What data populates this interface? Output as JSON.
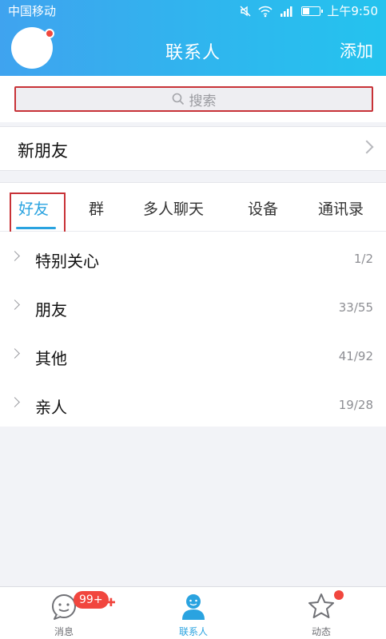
{
  "status_bar": {
    "carrier": "中国移动",
    "time": "上午9:50"
  },
  "header": {
    "title": "联系人",
    "add_label": "添加"
  },
  "search": {
    "placeholder": "搜索"
  },
  "new_friends": {
    "label": "新朋友"
  },
  "tabs": [
    {
      "label": "好友",
      "active": true
    },
    {
      "label": "群"
    },
    {
      "label": "多人聊天"
    },
    {
      "label": "设备"
    },
    {
      "label": "通讯录"
    }
  ],
  "groups": [
    {
      "name": "特别关心",
      "count": "1/2"
    },
    {
      "name": "朋友",
      "count": "33/55"
    },
    {
      "name": "其他",
      "count": "41/92"
    },
    {
      "name": "亲人",
      "count": "19/28"
    }
  ],
  "bottom_nav": {
    "items": [
      {
        "label": "消息",
        "badge": "99+"
      },
      {
        "label": "联系人",
        "active": true
      },
      {
        "label": "动态"
      }
    ]
  },
  "colors": {
    "accent": "#2aa3e0",
    "header_gradient_start": "#3fa3ef",
    "header_gradient_end": "#24c3ee",
    "badge_red": "#f1463e",
    "highlight_box": "#c83237"
  }
}
